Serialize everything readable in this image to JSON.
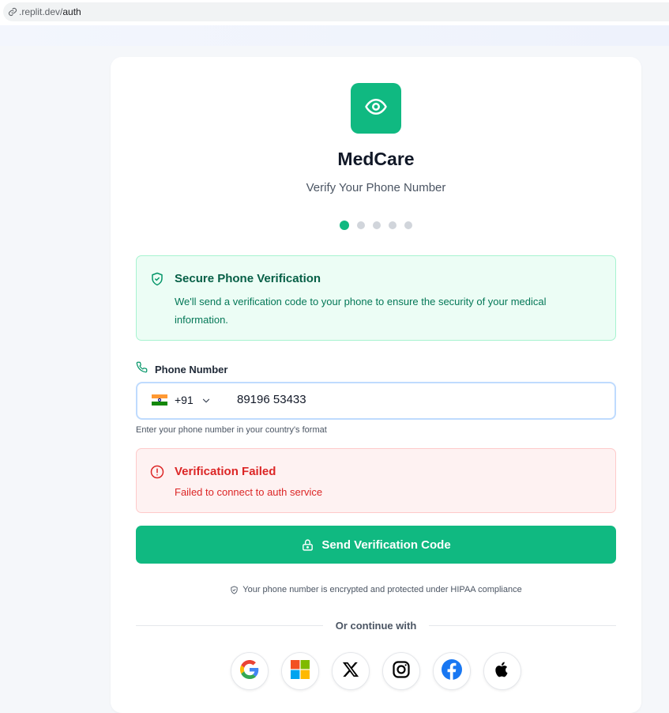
{
  "browser": {
    "url_host": ".replit.dev/",
    "url_path": "auth"
  },
  "app": {
    "name": "MedCare",
    "subtitle": "Verify Your Phone Number",
    "accent_color": "#10b981",
    "steps": {
      "total": 5,
      "current": 1
    }
  },
  "info": {
    "title": "Secure Phone Verification",
    "text": "We'll send a verification code to your phone to ensure the security of your medical information."
  },
  "phone": {
    "label": "Phone Number",
    "country_flag": "india-flag",
    "country_code": "+91",
    "value": "89196 53433",
    "helper": "Enter your phone number in your country's format"
  },
  "error": {
    "title": "Verification Failed",
    "message": "Failed to connect to auth service",
    "color": "#dc2626"
  },
  "actions": {
    "send_label": "Send Verification Code"
  },
  "footer": {
    "hipaa_note": "Your phone number is encrypted and protected under HIPAA compliance",
    "divider_text": "Or continue with"
  },
  "social_providers": [
    "google",
    "microsoft",
    "x",
    "instagram",
    "facebook",
    "apple"
  ]
}
